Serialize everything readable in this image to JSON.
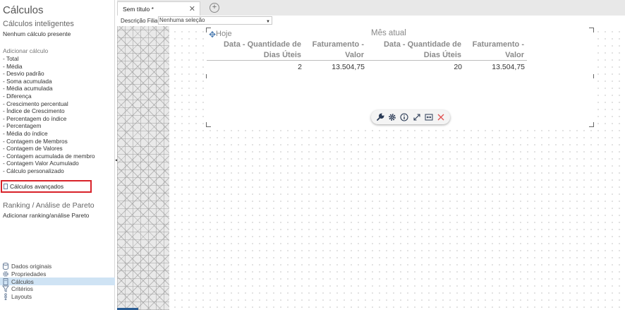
{
  "left_panel": {
    "title": "Cálculos",
    "smart_section": {
      "title": "Cálculos inteligentes",
      "empty_text": "Nenhum cálculo presente"
    },
    "add_calc": {
      "label": "Adicionar cálculo",
      "items": [
        "- Total",
        "- Média",
        "- Desvio padrão",
        "- Soma acumulada",
        "- Média acumulada",
        "- Diferença",
        "- Crescimento percentual",
        "- Índice de Crescimento",
        "- Percentagem do índice",
        "- Percentagem",
        "- Média do índice",
        "- Contagem de Membros",
        "- Contagem de Valores",
        "- Contagem acumulada de membro",
        "- Contagem Valor Acumulado",
        "- Cálculo personalizado"
      ]
    },
    "advanced": {
      "label": "Cálculos avançados",
      "highlight_color": "#d8232a"
    },
    "ranking": {
      "title": "Ranking / Análise de Pareto",
      "add_label": "Adicionar ranking/análise Pareto"
    },
    "nav": [
      {
        "label": "Dados originais",
        "icon": "database-icon",
        "active": false
      },
      {
        "label": "Propriedades",
        "icon": "gear-icon",
        "active": false
      },
      {
        "label": "Cálculos",
        "icon": "calculator-icon",
        "active": true
      },
      {
        "label": "Critérios",
        "icon": "filter-icon",
        "active": false
      },
      {
        "label": "Layouts",
        "icon": "layout-icon",
        "active": false
      }
    ]
  },
  "tabs": {
    "active_label": "Sem título *",
    "close_glyph": "✕",
    "add_glyph": "+"
  },
  "filter": {
    "label": "Descrição Filial",
    "value": "Nenhuma seleção"
  },
  "widget": {
    "group_today": "Hoje",
    "group_month": "Mês atual",
    "columns": [
      [
        "Data - Quantidade de",
        "Dias Úteis"
      ],
      [
        "Faturamento -",
        "Valor"
      ],
      [
        "Data - Quantidade de",
        "Dias Úteis"
      ],
      [
        "Faturamento -",
        "Valor"
      ]
    ],
    "row": [
      "2",
      "13.504,75",
      "20",
      "13.504,75"
    ],
    "toolbar": [
      "wrench-icon",
      "gear-icon",
      "info-icon",
      "expand-icon",
      "fit-width-icon",
      "close-icon"
    ]
  },
  "colors": {
    "accent": "#2b5d93",
    "nav_active_bg": "#cfe3f4",
    "close_red": "#e05050"
  }
}
